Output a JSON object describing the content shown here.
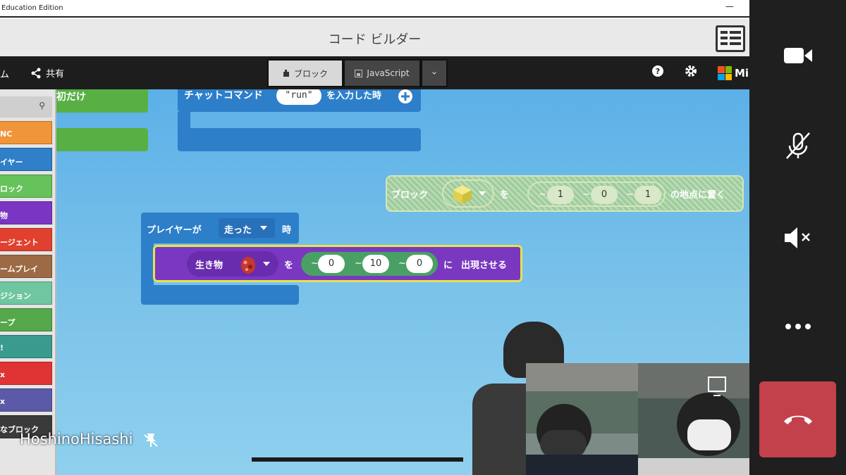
{
  "window": {
    "title": "Education Edition",
    "minimize": "—"
  },
  "titlebar": {
    "title": "コード ビルダー"
  },
  "toolbar": {
    "home_label": "ム",
    "share_label": "共有",
    "tabs": [
      {
        "label": "ブロック",
        "active": true
      },
      {
        "label": "JavaScript",
        "active": false
      }
    ],
    "brand": "Mi"
  },
  "sidebar": {
    "categories": [
      {
        "label": "NC",
        "color": "#f0953a"
      },
      {
        "label": "イヤー",
        "color": "#2f7fc9"
      },
      {
        "label": "ロック",
        "color": "#66c25a"
      },
      {
        "label": "物",
        "color": "#7a36c2"
      },
      {
        "label": "ージェント",
        "color": "#e2402f"
      },
      {
        "label": "ームプレイ",
        "color": "#9c6a44"
      },
      {
        "label": "ジション",
        "color": "#6fc6a0"
      },
      {
        "label": "ープ",
        "color": "#55a84a"
      },
      {
        "label": "!",
        "color": "#3a9a8e"
      },
      {
        "label": "x",
        "color": "#e03333"
      },
      {
        "label": "x",
        "color": "#5a5aa8"
      },
      {
        "label": "なブロック",
        "color": "#3a3a3a"
      }
    ]
  },
  "workspace": {
    "first_block_label": "初だけ",
    "chat_block": {
      "prefix": "チャットコマンド",
      "command": "\"run\"",
      "suffix": "を入力した時"
    },
    "place_block": {
      "prefix": "ブロック",
      "particle": "を",
      "coords": [
        "1",
        "0",
        "1"
      ],
      "suffix": "の地点に置く"
    },
    "player_block": {
      "prefix": "プレイヤーが",
      "action": "走った",
      "suffix": "時"
    },
    "spawn_block": {
      "prefix": "生き物",
      "particle": "を",
      "coords": [
        "0",
        "10",
        "0"
      ],
      "suffix_part1": "に",
      "suffix_part2": "出現させる"
    }
  },
  "participant": {
    "name": "HoshinoHisashi"
  }
}
